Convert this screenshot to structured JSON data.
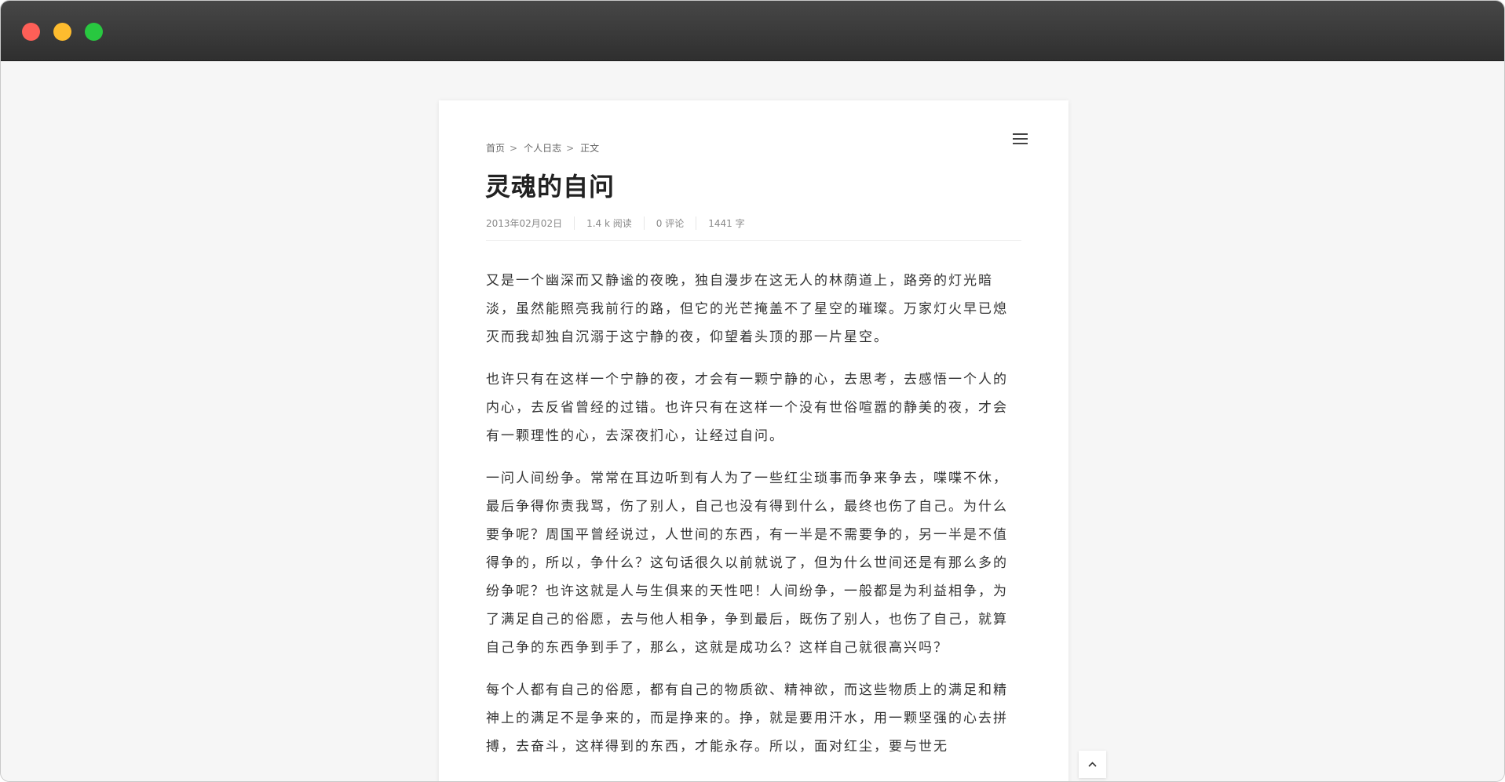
{
  "breadcrumb": {
    "home": "首页",
    "category": "个人日志",
    "current": "正文",
    "separator": ">"
  },
  "post": {
    "title": "灵魂的自问",
    "date": "2013年02月02日",
    "views": "1.4 k 阅读",
    "comments": "0 评论",
    "words": "1441 字"
  },
  "article": {
    "paragraphs": [
      "又是一个幽深而又静谧的夜晚，独自漫步在这无人的林荫道上，路旁的灯光暗淡，虽然能照亮我前行的路，但它的光芒掩盖不了星空的璀璨。万家灯火早已熄灭而我却独自沉溺于这宁静的夜，仰望着头顶的那一片星空。",
      "也许只有在这样一个宁静的夜，才会有一颗宁静的心，去思考，去感悟一个人的内心，去反省曾经的过错。也许只有在这样一个没有世俗喧嚣的静美的夜，才会有一颗理性的心，去深夜扪心，让经过自问。",
      "一问人间纷争。常常在耳边听到有人为了一些红尘琐事而争来争去，喋喋不休，最后争得你责我骂，伤了别人，自己也没有得到什么，最终也伤了自己。为什么要争呢？周国平曾经说过，人世间的东西，有一半是不需要争的，另一半是不值得争的，所以，争什么？这句话很久以前就说了，但为什么世间还是有那么多的纷争呢？也许这就是人与生俱来的天性吧！人间纷争，一般都是为利益相争，为了满足自己的俗愿，去与他人相争，争到最后，既伤了别人，也伤了自己，就算自己争的东西争到手了，那么，这就是成功么？这样自己就很高兴吗？",
      "每个人都有自己的俗愿，都有自己的物质欲、精神欲，而这些物质上的满足和精神上的满足不是争来的，而是挣来的。挣，就是要用汗水，用一颗坚强的心去拼搏，去奋斗，这样得到的东西，才能永存。所以，面对红尘，要与世无"
    ]
  },
  "icons": {
    "menu": "hamburger-icon",
    "back_to_top": "chevron-up-icon"
  },
  "colors": {
    "titlebar": "#3a3a3a",
    "close": "#fe5f57",
    "minimize": "#febc2e",
    "maximize": "#28c840"
  }
}
